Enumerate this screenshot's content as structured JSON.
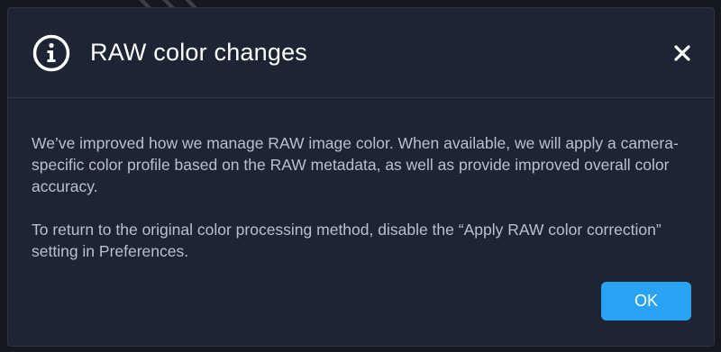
{
  "dialog": {
    "title": "RAW color changes",
    "icon": "info-icon",
    "close_icon": "close-icon",
    "paragraphs": [
      "We’ve improved how we manage RAW image color. When available, we will apply a camera-specific color profile based on the RAW metadata, as well as provide improved overall color accuracy.",
      "To return to the original color processing method, disable the “Apply RAW color correction” setting in Preferences."
    ],
    "ok_label": "OK"
  },
  "colors": {
    "background": "#15181f",
    "dialog_bg": "#1d2433",
    "accent": "#2aa3f7",
    "title_text": "#ffffff",
    "body_text": "#b9c0cc"
  }
}
